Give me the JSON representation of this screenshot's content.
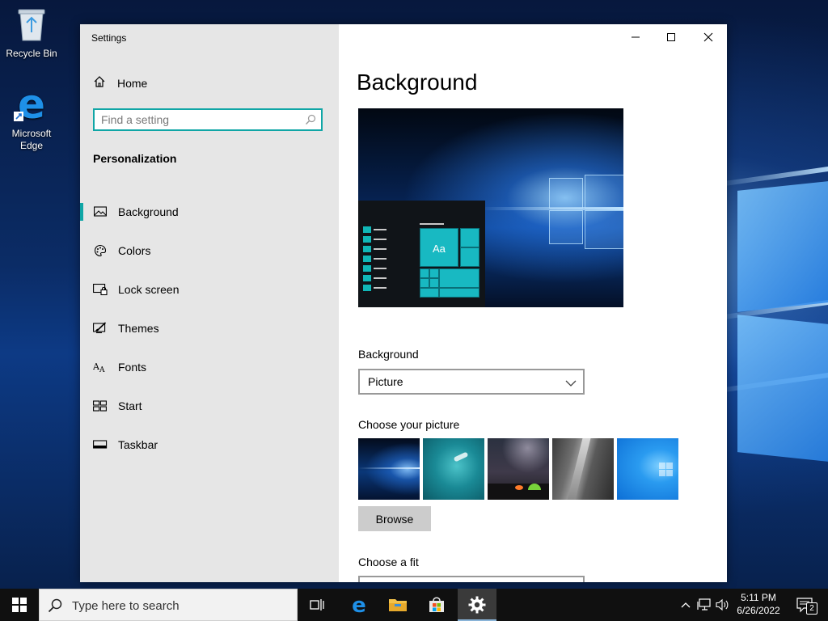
{
  "desktop": {
    "icons": [
      {
        "label": "Recycle Bin"
      },
      {
        "label": "Microsoft Edge"
      }
    ]
  },
  "window": {
    "title": "Settings"
  },
  "sidebar": {
    "home_label": "Home",
    "search_placeholder": "Find a setting",
    "section_title": "Personalization",
    "items": [
      {
        "label": "Background",
        "icon": "picture-icon",
        "active": true
      },
      {
        "label": "Colors",
        "icon": "palette-icon",
        "active": false
      },
      {
        "label": "Lock screen",
        "icon": "lock-screen-icon",
        "active": false
      },
      {
        "label": "Themes",
        "icon": "themes-icon",
        "active": false
      },
      {
        "label": "Fonts",
        "icon": "fonts-icon",
        "active": false
      },
      {
        "label": "Start",
        "icon": "start-icon",
        "active": false
      },
      {
        "label": "Taskbar",
        "icon": "taskbar-icon",
        "active": false
      }
    ]
  },
  "content": {
    "page_title": "Background",
    "preview_tile_text": "Aa",
    "background_label": "Background",
    "background_value": "Picture",
    "choose_picture_label": "Choose your picture",
    "browse_label": "Browse",
    "choose_fit_label": "Choose a fit"
  },
  "taskbar": {
    "search_placeholder": "Type here to search",
    "clock_time": "5:11 PM",
    "clock_date": "6/26/2022",
    "notification_count": "2"
  },
  "colors": {
    "accent": "#10a6a6",
    "sidebar_bg": "#e6e6e6",
    "taskbar_bg": "#101010"
  }
}
